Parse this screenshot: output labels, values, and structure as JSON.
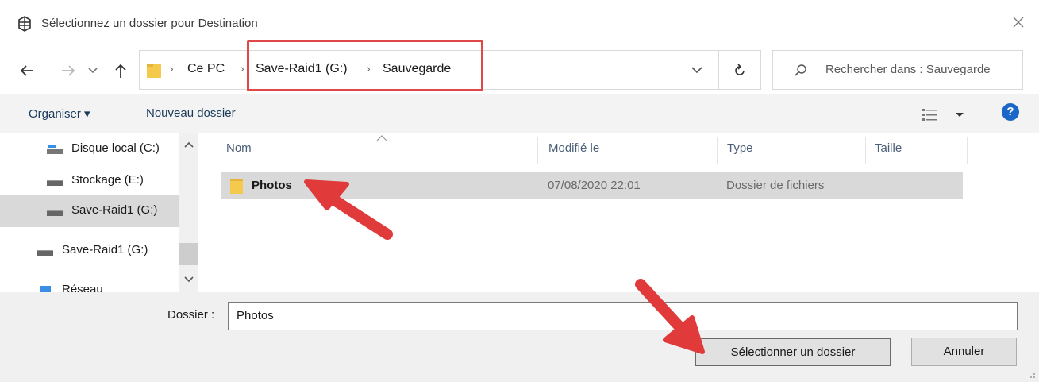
{
  "window": {
    "title": "Sélectionnez un dossier pour Destination"
  },
  "breadcrumb": {
    "items": [
      "Ce PC",
      "Save-Raid1 (G:)",
      "Sauvegarde"
    ],
    "separator": "›"
  },
  "search": {
    "placeholder": "Rechercher dans : Sauvegarde"
  },
  "toolbar": {
    "organize": "Organiser ▾",
    "new_folder": "Nouveau dossier"
  },
  "sidebar": {
    "items": [
      {
        "label": "Disque local (C:)",
        "icon": "local-disk-icon"
      },
      {
        "label": "Stockage (E:)",
        "icon": "drive-icon"
      },
      {
        "label": "Save-Raid1 (G:)",
        "icon": "drive-icon",
        "selected": true
      },
      {
        "label": "Save-Raid1 (G:)",
        "icon": "drive-icon"
      },
      {
        "label": "Réseau",
        "icon": "network-icon"
      }
    ]
  },
  "list": {
    "columns": [
      "Nom",
      "Modifié le",
      "Type",
      "Taille"
    ],
    "rows": [
      {
        "name": "Photos",
        "modified": "07/08/2020 22:01",
        "type": "Dossier de fichiers",
        "size": ""
      }
    ]
  },
  "footer": {
    "folder_label": "Dossier :",
    "folder_value": "Photos",
    "select_button": "Sélectionner un dossier",
    "cancel_button": "Annuler"
  },
  "colors": {
    "highlight": "#e04848",
    "accent": "#1a67c8"
  }
}
